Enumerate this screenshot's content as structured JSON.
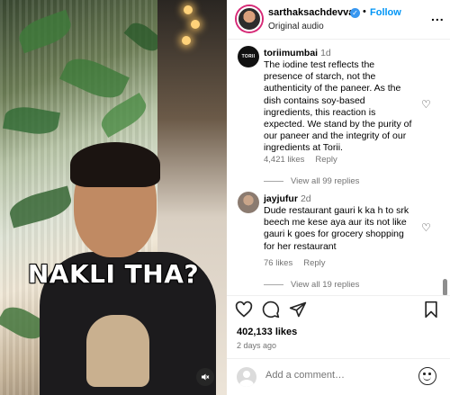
{
  "video": {
    "caption": "NAKLI THA?",
    "mute_icon": "speaker-muted-icon"
  },
  "post": {
    "username": "sarthaksachdevva",
    "verified_icon": "verified-badge-icon",
    "separator": "•",
    "follow_label": "Follow",
    "audio": "Original audio",
    "more_icon": "..."
  },
  "comments": [
    {
      "avatar_text": "TORII",
      "username": "toriimumbai",
      "time": "1d",
      "text": "The iodine test reflects the presence of starch, not the authenticity of the paneer. As the dish contains soy-based ingredients, this reaction is expected. We stand by the purity of our paneer and the integrity of our ingredients at Torii.",
      "likes": "4,421 likes",
      "reply_label": "Reply",
      "view_replies": "View all 99 replies"
    },
    {
      "username": "jayjufur",
      "time": "2d",
      "text": "Dude restaurant gauri k ka h to srk beech me kese aya aur its not like gauri k goes for grocery shopping for her restaurant",
      "likes": "76 likes",
      "reply_label": "Reply",
      "view_replies": "View all 19 replies"
    }
  ],
  "actions": {
    "like_icon": "heart-icon",
    "comment_icon": "comment-icon",
    "share_icon": "send-icon",
    "save_icon": "bookmark-icon",
    "likes_count": "402,133 likes",
    "posted": "2 days ago"
  },
  "add_comment": {
    "placeholder": "Add a comment…",
    "emoji_icon": "emoji-icon"
  }
}
